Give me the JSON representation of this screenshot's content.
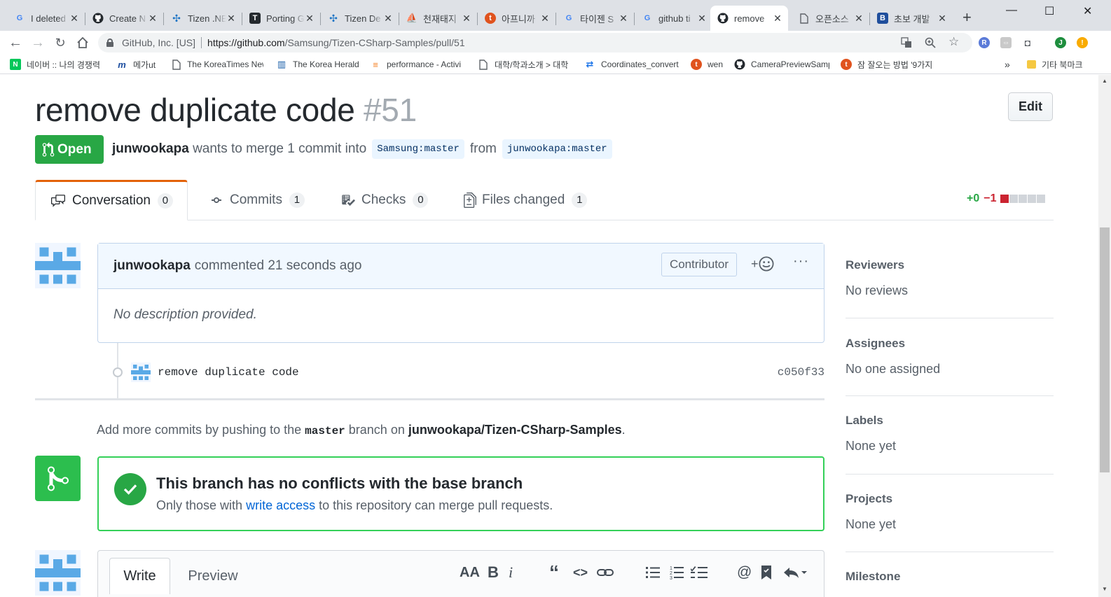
{
  "browser": {
    "tabs": [
      {
        "title": "I deleted",
        "favicon": "G",
        "favicon_color": "#4285f4"
      },
      {
        "title": "Create N",
        "favicon": "github-icon",
        "favicon_color": "#24292e"
      },
      {
        "title": "Tizen .NE",
        "favicon": "tizen-icon",
        "favicon_color": "#1a73c4"
      },
      {
        "title": "Porting G",
        "favicon": "T",
        "favicon_color": "#24292e"
      },
      {
        "title": "Tizen De",
        "favicon": "tizen-icon",
        "favicon_color": "#1a73c4"
      },
      {
        "title": "천재태지",
        "favicon": "blog-icon",
        "favicon_color": "#e8a317"
      },
      {
        "title": "아프니까",
        "favicon": "t",
        "favicon_color": "#e0531e"
      },
      {
        "title": "타이젠 S",
        "favicon": "G",
        "favicon_color": "#4285f4"
      },
      {
        "title": "github ti",
        "favicon": "G",
        "favicon_color": "#4285f4"
      },
      {
        "title": "remove",
        "favicon": "github-icon",
        "favicon_color": "#24292e",
        "active": true
      },
      {
        "title": "오픈소스",
        "favicon": "page-icon",
        "favicon_color": "#5f6368"
      },
      {
        "title": "초보 개발",
        "favicon": "B",
        "favicon_color": "#1f4e9c"
      }
    ],
    "new_tab": "+",
    "window_controls": {
      "minimize": "—",
      "maximize": "☐",
      "close": "✕"
    },
    "address": {
      "site_identity": "GitHub, Inc. [US]",
      "url_host": "https://github.com",
      "url_path": "/Samsung/Tizen-CSharp-Samples/pull/51"
    },
    "bookmarks": [
      {
        "label": "네이버 :: 나의 경쟁력",
        "favicon": "N",
        "color": "#03c75a"
      },
      {
        "label": "메가ut",
        "favicon": "m",
        "color": "#1e4fa0"
      },
      {
        "label": "The KoreaTimes New",
        "favicon": "page-icon",
        "color": "#5f6368"
      },
      {
        "label": "The Korea Herald",
        "favicon": "herald-icon",
        "color": "#1a5ea8"
      },
      {
        "label": "performance - Activi",
        "favicon": "stack-icon",
        "color": "#f48024"
      },
      {
        "label": "대학/학과소개 > 대학",
        "favicon": "page-icon",
        "color": "#5f6368"
      },
      {
        "label": "Coordinates_convert",
        "favicon": "arrows-icon",
        "color": "#1a73e8"
      },
      {
        "label": "wen",
        "favicon": "t",
        "color": "#e0531e"
      },
      {
        "label": "CameraPreviewSamp",
        "favicon": "github-icon",
        "color": "#24292e"
      },
      {
        "label": "잠 잘오는 방법 '9가지",
        "favicon": "t",
        "color": "#e0531e"
      }
    ],
    "bookmarks_more": "»",
    "other_bookmarks": "기타 북마크"
  },
  "pr": {
    "title": "remove duplicate code",
    "number": "#51",
    "edit_label": "Edit",
    "state": "Open",
    "author": "junwookapa",
    "merge_text": "wants to merge 1 commit into",
    "base_branch": "Samsung:master",
    "from_text": "from",
    "head_branch": "junwookapa:master",
    "tabs": [
      {
        "label": "Conversation",
        "count": "0"
      },
      {
        "label": "Commits",
        "count": "1"
      },
      {
        "label": "Checks",
        "count": "0"
      },
      {
        "label": "Files changed",
        "count": "1"
      }
    ],
    "diffstat": {
      "additions": "+0",
      "deletions": "−1",
      "blocks": [
        "del",
        "neutral",
        "neutral",
        "neutral",
        "neutral"
      ]
    }
  },
  "comment": {
    "author": "junwookapa",
    "action": "commented 21 seconds ago",
    "role": "Contributor",
    "reaction": "+☺",
    "menu": "···",
    "body": "No description provided."
  },
  "commit": {
    "message": "remove duplicate code",
    "sha": "c050f33"
  },
  "push_hint": {
    "prefix": "Add more commits by pushing to the",
    "branch": "master",
    "middle": "branch on",
    "repo": "junwookapa/Tizen-CSharp-Samples",
    "suffix": "."
  },
  "merge": {
    "title": "This branch has no conflicts with the base branch",
    "sub_prefix": "Only those with",
    "link": "write access",
    "sub_suffix": "to this repository can merge pull requests."
  },
  "editor": {
    "tabs": [
      "Write",
      "Preview"
    ],
    "tools": [
      "AA",
      "B",
      "i",
      "“",
      "<>",
      "link",
      "ul",
      "ol",
      "task",
      "@",
      "bookmark",
      "reply"
    ]
  },
  "sidebar": [
    {
      "heading": "Reviewers",
      "value": "No reviews"
    },
    {
      "heading": "Assignees",
      "value": "No one assigned"
    },
    {
      "heading": "Labels",
      "value": "None yet"
    },
    {
      "heading": "Projects",
      "value": "None yet"
    },
    {
      "heading": "Milestone",
      "value": ""
    }
  ],
  "colors": {
    "open": "#28a745",
    "accent_tab": "#e36209",
    "link": "#0366d6",
    "deletion": "#cb2431"
  }
}
